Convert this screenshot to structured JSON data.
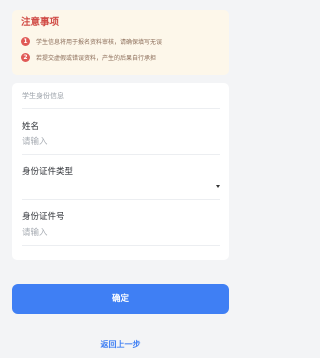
{
  "notice": {
    "title": "注意事项",
    "items": [
      {
        "num": "1",
        "text": "学生信息将用于报名资料审核，请确保填写无误"
      },
      {
        "num": "2",
        "text": "若提交虚假或错误资料，产生的后果自行承担"
      }
    ]
  },
  "form": {
    "section_title": "学生身份信息",
    "name": {
      "label": "姓名",
      "placeholder": "请输入",
      "value": ""
    },
    "id_type": {
      "label": "身份证件类型",
      "value": ""
    },
    "id_number": {
      "label": "身份证件号",
      "placeholder": "请输入",
      "value": ""
    }
  },
  "actions": {
    "confirm_label": "确定",
    "back_label": "返回上一步"
  },
  "colors": {
    "accent": "#3f7ff4",
    "notice_title": "#d04b45",
    "notice_bg": "#fdf7ea"
  }
}
